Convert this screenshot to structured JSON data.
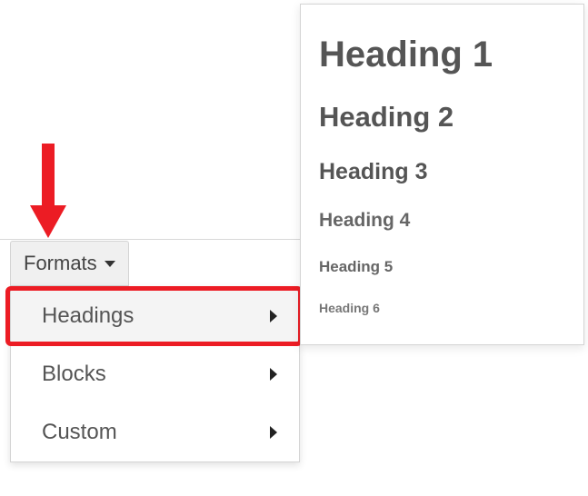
{
  "toolbar": {
    "formats_label": "Formats"
  },
  "submenu": {
    "items": [
      {
        "label": "Headings"
      },
      {
        "label": "Blocks"
      },
      {
        "label": "Custom"
      }
    ]
  },
  "headings_panel": {
    "items": [
      {
        "label": "Heading 1"
      },
      {
        "label": "Heading 2"
      },
      {
        "label": "Heading 3"
      },
      {
        "label": "Heading 4"
      },
      {
        "label": "Heading 5"
      },
      {
        "label": "Heading 6"
      }
    ]
  }
}
